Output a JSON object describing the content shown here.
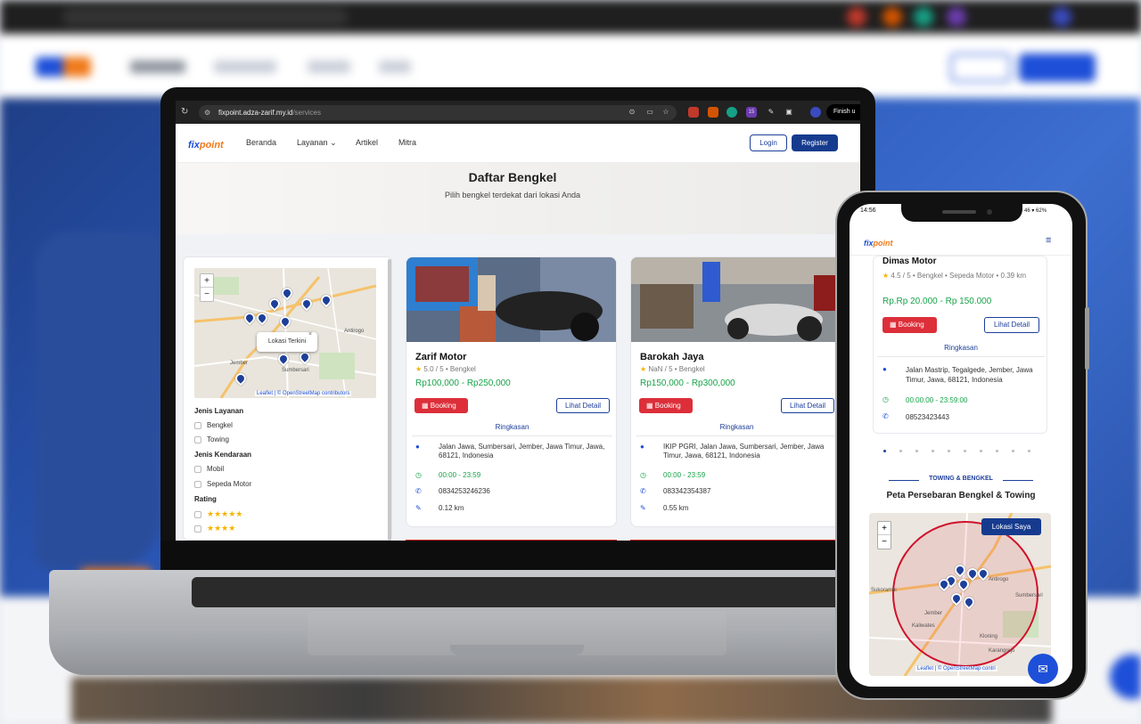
{
  "laptop": {
    "browser": {
      "url_host": "fixpoint.adza-zarif.my.id",
      "url_path": "/services",
      "finish_label": "Finish u",
      "profile_badge": "15"
    },
    "nav": {
      "logo_a": "fix",
      "logo_b": "point",
      "items": [
        "Beranda",
        "Layanan",
        "Artikel",
        "Mitra"
      ],
      "login_label": "Login",
      "register_label": "Register"
    },
    "hero": {
      "title": "Daftar Bengkel",
      "subtitle": "Pilih bengkel terdekat dari lokasi Anda"
    },
    "filter": {
      "map_popup": "Lokasi Terkini",
      "map_attribution": "Leaflet | © OpenStreetMap contributors",
      "map_places": [
        "Antirogo",
        "Jember",
        "Sumbersari"
      ],
      "zoom_in": "+",
      "zoom_out": "−",
      "section_service": "Jenis Layanan",
      "service_options": [
        "Bengkel",
        "Towing"
      ],
      "section_vehicle": "Jenis Kendaraan",
      "vehicle_options": [
        "Mobil",
        "Sepeda Motor"
      ],
      "section_rating": "Rating",
      "rating_rows": [
        "★★★★★",
        "★★★★"
      ]
    },
    "cards": [
      {
        "name": "Zarif Motor",
        "rating": "5.0 / 5 • Bengkel",
        "price": "Rp100,000 - Rp250,000",
        "booking_label": "Booking",
        "detail_label": "Lihat Detail",
        "summary_label": "Ringkasan",
        "address": "Jalan Jawa, Sumbersari, Jember, Jawa Timur, Jawa, 68121, Indonesia",
        "hours": "00:00 - 23:59",
        "phone": "0834253246236",
        "distance": "0.12 km"
      },
      {
        "name": "Barokah Jaya",
        "rating": "NaN / 5 • Bengkel",
        "price": "Rp150,000 - Rp300,000",
        "booking_label": "Booking",
        "detail_label": "Lihat Detail",
        "summary_label": "Ringkasan",
        "address": "IKIP PGRI, Jalan Jawa, Sumbersari, Jember, Jawa Timur, Jawa, 68121, Indonesia",
        "hours": "00:00 - 23:59",
        "phone": "083342354387",
        "distance": "0.55 km"
      }
    ]
  },
  "phone": {
    "status_time": "14:56",
    "status_right": "46 ▾ 62%",
    "logo_a": "fix",
    "logo_b": "point",
    "menu_icon": "≡",
    "card": {
      "name": "Dimas Motor",
      "rating": "4.5 / 5 • Bengkel • Sepeda Motor • 0.39 km",
      "price": "Rp.Rp 20.000 - Rp 150.000",
      "booking_label": "Booking",
      "detail_label": "Lihat Detail",
      "summary_label": "Ringkasan",
      "address": "Jalan Mastrip, Tegalgede, Jember, Jawa Timur, Jawa, 68121, Indonesia",
      "hours": "00:00:00 - 23:59:00",
      "phone": "08523423443"
    },
    "section_tag": "TOWING & BENGKEL",
    "section_title": "Peta Persebaran Bengkel & Towing",
    "map_button": "Lokasi Saya",
    "map_attribution": "Leaflet | © OpenStreetMap contri",
    "map_places": [
      "Sukorambi",
      "Jember",
      "Kaliwates",
      "Kloning",
      "Antirogo",
      "Sumbersari",
      "Karangrejo"
    ],
    "zoom_in": "+",
    "zoom_out": "−"
  },
  "background": {
    "nav_items": [
      "Beranda",
      "Layanan",
      "Artikel",
      "Mitra"
    ],
    "login_label": "Login",
    "register_label": "Register",
    "url": "fixpoint.adza-zarif.my.id"
  },
  "colors": {
    "brand_blue": "#1d3f99",
    "brand_orange": "#f07a1a",
    "price_green": "#18a34a",
    "booking_red": "#dc2f3a"
  }
}
